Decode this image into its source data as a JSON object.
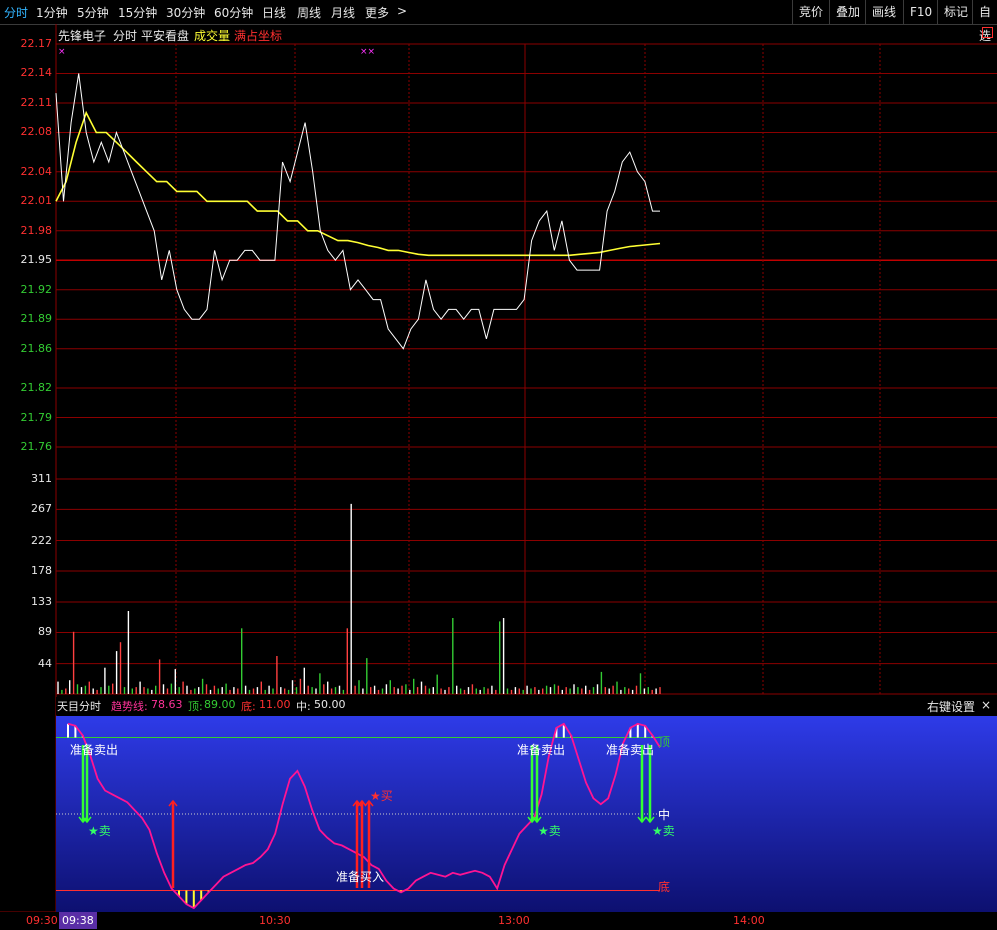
{
  "toolbar": {
    "tabs": [
      "分时",
      "1分钟",
      "5分钟",
      "15分钟",
      "30分钟",
      "60分钟",
      "日线",
      "周线",
      "月线",
      "更多"
    ],
    "more_arrow": ">",
    "right_buttons": [
      "竞价",
      "叠加",
      "画线",
      "F10",
      "标记",
      "自选"
    ]
  },
  "title_bar": {
    "stock_name": "先锋电子",
    "view": "分时",
    "plan": "平安看盘",
    "volume_label": "成交量",
    "coord_label": "满占坐标",
    "corner_icon": "window-restore-icon"
  },
  "price_axis": [
    "22.17",
    "22.14",
    "22.11",
    "22.08",
    "22.04",
    "22.01",
    "21.98",
    "21.95",
    "21.92",
    "21.89",
    "21.86",
    "21.82",
    "21.79",
    "21.76"
  ],
  "volume_axis": [
    "311",
    "267",
    "222",
    "178",
    "133",
    "89",
    "44"
  ],
  "indicator": {
    "name": "天目分时",
    "trend_label": "趋势线:",
    "trend_value": "78.63",
    "top_label": "顶:",
    "top_value": "89.00",
    "bottom_label": "底:",
    "bottom_value": "11.00",
    "mid_label": "中:",
    "mid_value": "50.00",
    "settings": "右键设置",
    "close": "×",
    "line_top": "顶",
    "line_mid": "中",
    "line_bottom": "底",
    "prepare_sell": "准备卖出",
    "prepare_buy": "准备买入",
    "sell": "★卖",
    "buy": "★买"
  },
  "time_axis": {
    "start": "09:30",
    "cursor": "09:38",
    "ticks": [
      "10:30",
      "13:00",
      "14:00"
    ]
  },
  "colors": {
    "background": "#000000",
    "grid": "#8b0000",
    "price_line": "#ffffff",
    "avg_line": "#ffff33",
    "up": "#ff4040",
    "down": "#33cc33",
    "indicator_line": "#ff1493",
    "indicator_bg_top": "#2e3be8",
    "indicator_bg_bottom": "#0d1070"
  },
  "chart_data": {
    "type": "line",
    "title": "",
    "ylim": [
      21.76,
      22.17
    ],
    "series": [
      {
        "values": [
          22.12,
          22.01,
          22.09,
          22.14,
          22.08,
          22.05,
          22.07,
          22.05,
          22.08,
          22.06,
          22.04,
          22.02,
          22.0,
          21.98,
          21.93,
          21.96,
          21.92,
          21.9,
          21.89,
          21.89,
          21.9,
          21.96,
          21.93,
          21.95,
          21.95,
          21.96,
          21.96,
          21.95,
          21.95,
          21.95,
          22.05,
          22.03,
          22.06,
          22.09,
          22.04,
          21.98,
          21.96,
          21.95,
          21.96,
          21.92,
          21.93,
          21.92,
          21.91,
          21.91,
          21.88,
          21.87,
          21.86,
          21.88,
          21.89,
          21.93,
          21.9,
          21.89,
          21.9,
          21.9,
          21.89,
          21.9,
          21.9,
          21.87,
          21.9,
          21.9,
          21.9,
          21.9,
          21.91,
          21.97,
          21.99,
          22.0,
          21.96,
          21.99,
          21.95,
          21.94,
          21.94,
          21.94,
          21.94,
          22.0,
          22.02,
          22.05,
          22.06,
          22.04,
          22.03,
          22.0,
          22.0
        ]
      },
      {
        "values": [
          22.01,
          22.03,
          22.07,
          22.1,
          22.08,
          22.08,
          22.07,
          22.06,
          22.05,
          22.04,
          22.03,
          22.03,
          22.02,
          22.02,
          22.02,
          22.01,
          22.01,
          22.01,
          22.01,
          22.01,
          22.0,
          22.0,
          22.0,
          21.99,
          21.99,
          21.98,
          21.98,
          21.975,
          21.97,
          21.97,
          21.968,
          21.965,
          21.963,
          21.96,
          21.96,
          21.958,
          21.956,
          21.955,
          21.955,
          21.955,
          21.955,
          21.955,
          21.955,
          21.955,
          21.955,
          21.955,
          21.955,
          21.955,
          21.955,
          21.955,
          21.955,
          21.955,
          21.956,
          21.957,
          21.958,
          21.96,
          21.962,
          21.964,
          21.965,
          21.966,
          21.967
        ]
      }
    ],
    "volume": {
      "ylim": [
        0,
        311
      ],
      "values": [
        18,
        6,
        8,
        20,
        90,
        14,
        10,
        12,
        18,
        8,
        6,
        10,
        38,
        12,
        15,
        62,
        75,
        10,
        120,
        8,
        10,
        18,
        10,
        8,
        6,
        12,
        50,
        14,
        8,
        15,
        36,
        10,
        18,
        12,
        6,
        8,
        10,
        22,
        14,
        6,
        12,
        8,
        10,
        15,
        6,
        10,
        8,
        95,
        12,
        6,
        8,
        10,
        18,
        6,
        12,
        8,
        55,
        10,
        8,
        6,
        20,
        10,
        22,
        38,
        12,
        10,
        8,
        30,
        14,
        18,
        8,
        10,
        12,
        6,
        95,
        275,
        12,
        20,
        8,
        52,
        10,
        12,
        6,
        8,
        14,
        20,
        10,
        8,
        12,
        14,
        6,
        22,
        10,
        18,
        12,
        8,
        10,
        28,
        8,
        6,
        10,
        110,
        12,
        8,
        6,
        10,
        14,
        8,
        6,
        10,
        8,
        12,
        6,
        105,
        110,
        8,
        6,
        10,
        8,
        6,
        12,
        8,
        10,
        6,
        8,
        12,
        10,
        14,
        12,
        6,
        10,
        8,
        14,
        10,
        8,
        12,
        6,
        10,
        14,
        32,
        10,
        8,
        12,
        18,
        6,
        10,
        8,
        6,
        12,
        30,
        8,
        10,
        6,
        8,
        10
      ]
    },
    "indicator_series": {
      "ylim": [
        0,
        100
      ],
      "top": 89,
      "mid": 50,
      "bottom": 11,
      "values": [
        96,
        95,
        90,
        80,
        68,
        62,
        60,
        58,
        56,
        52,
        48,
        42,
        30,
        20,
        12,
        8,
        4,
        2,
        6,
        10,
        14,
        18,
        20,
        22,
        24,
        25,
        28,
        32,
        40,
        55,
        68,
        72,
        64,
        52,
        42,
        38,
        35,
        34,
        32,
        30,
        28,
        24,
        22,
        16,
        12,
        10,
        12,
        16,
        18,
        20,
        19,
        18,
        20,
        19,
        20,
        21,
        20,
        18,
        12,
        24,
        32,
        40,
        44,
        48,
        60,
        80,
        94,
        96,
        90,
        78,
        66,
        58,
        55,
        58,
        70,
        86,
        94,
        96,
        95,
        90,
        84
      ]
    }
  }
}
